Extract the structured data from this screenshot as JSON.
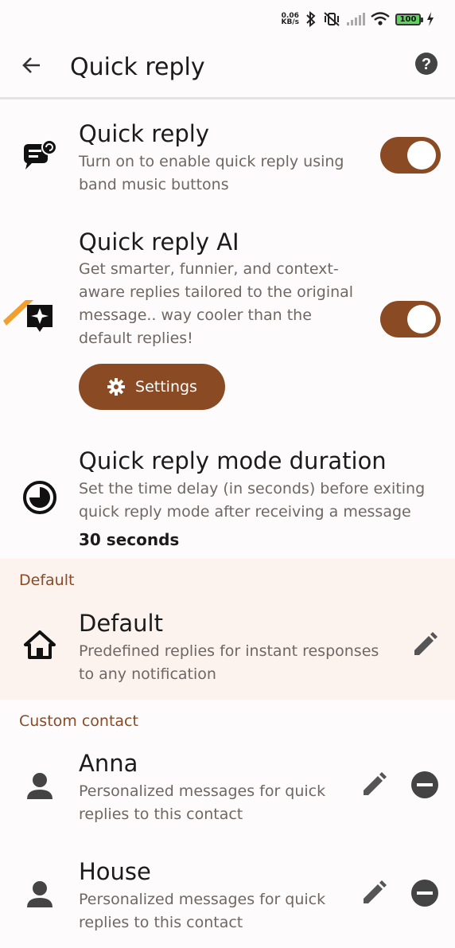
{
  "status_bar": {
    "net_speed_value": "0.06",
    "net_speed_unit": "KB/s",
    "battery": "100",
    "icons": [
      "bluetooth-icon",
      "vibrate-icon",
      "signal-icon",
      "wifi-icon",
      "battery-icon",
      "charging-icon"
    ]
  },
  "app_bar": {
    "title": "Quick reply",
    "icons": [
      "back-arrow-icon",
      "help-icon"
    ]
  },
  "settings": {
    "quick_reply": {
      "title": "Quick reply",
      "subtitle": "Turn on to enable quick reply using band music buttons",
      "enabled": true
    },
    "quick_reply_ai": {
      "title": "Quick reply AI",
      "subtitle": "Get smarter, funnier, and context-aware replies tailored to the original message.. way cooler than the default replies!",
      "enabled": true,
      "settings_button": "Settings"
    },
    "duration": {
      "title": "Quick reply mode duration",
      "subtitle": "Set the time delay (in seconds) before exiting quick reply mode after receiving a message",
      "value": "30 seconds"
    }
  },
  "default_section": {
    "header": "Default",
    "item": {
      "title": "Default",
      "subtitle": "Predefined replies for instant responses to any notification"
    }
  },
  "custom_section": {
    "header": "Custom contact",
    "contacts": [
      {
        "name": "Anna",
        "subtitle": "Personalized messages for quick replies to this contact"
      },
      {
        "name": "House",
        "subtitle": "Personalized messages for quick replies to this contact"
      }
    ]
  },
  "colors": {
    "accent": "#8a4a24",
    "default_band": "#fcf2ee",
    "section_header": "#8a4a24"
  }
}
